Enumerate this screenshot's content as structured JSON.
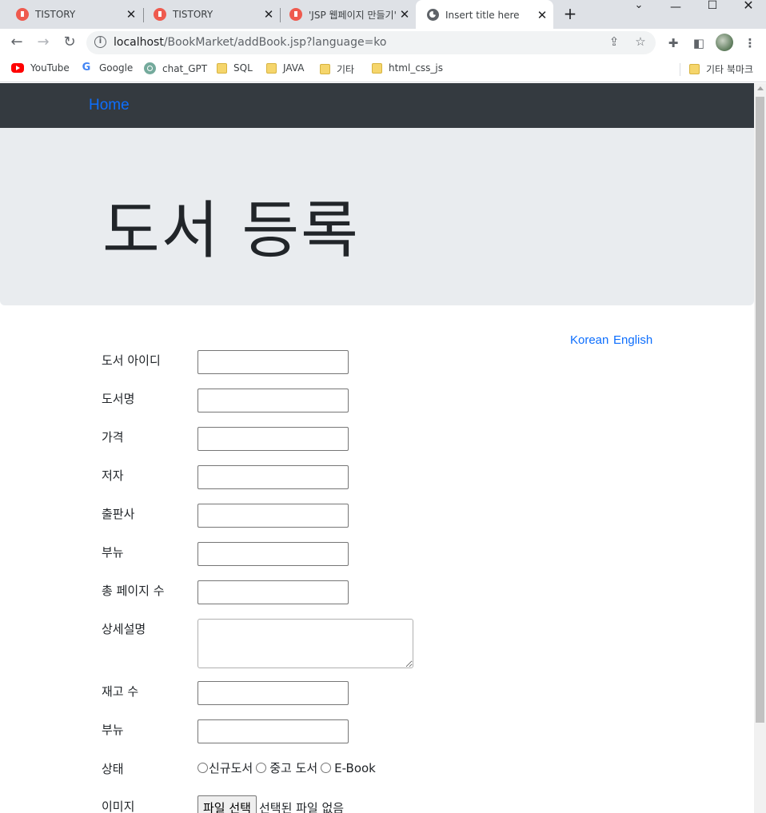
{
  "browser": {
    "tabs": [
      {
        "title": "TISTORY",
        "icon": "tistory-icon"
      },
      {
        "title": "TISTORY",
        "icon": "tistory-icon"
      },
      {
        "title": "'JSP 웹페이지 만들기'",
        "icon": "tistory-icon"
      },
      {
        "title": "Insert title here",
        "icon": "globe-icon",
        "active": true
      }
    ],
    "url_host": "localhost",
    "url_path": "/BookMarket/addBook.jsp?language=ko",
    "bookmarks": [
      {
        "label": "YouTube",
        "icon": "youtube-icon"
      },
      {
        "label": "Google",
        "icon": "google-icon"
      },
      {
        "label": "chat_GPT",
        "icon": "chatgpt-icon"
      },
      {
        "label": "SQL",
        "icon": "folder-icon"
      },
      {
        "label": "JAVA",
        "icon": "folder-icon"
      },
      {
        "label": "기타",
        "icon": "folder-icon"
      },
      {
        "label": "html_css_js",
        "icon": "folder-icon"
      }
    ],
    "other_bookmarks": "기타 북마크"
  },
  "navbar": {
    "brand": "Home"
  },
  "jumbotron": {
    "title": "도서 등록"
  },
  "lang_links": {
    "korean": "Korean",
    "english": "English"
  },
  "form": {
    "fields": [
      {
        "label": "도서 아이디",
        "value": ""
      },
      {
        "label": "도서명",
        "value": ""
      },
      {
        "label": "가격",
        "value": ""
      },
      {
        "label": "저자",
        "value": ""
      },
      {
        "label": "출판사",
        "value": ""
      },
      {
        "label": "부뉴",
        "value": ""
      },
      {
        "label": "총 페이지 수",
        "value": ""
      },
      {
        "label": "상세설명",
        "value": ""
      },
      {
        "label": "재고 수",
        "value": ""
      },
      {
        "label": "부뉴",
        "value": ""
      }
    ],
    "condition": {
      "label": "상태",
      "options": [
        "신규도서",
        "중고 도서",
        "E-Book"
      ]
    },
    "image": {
      "label": "이미지",
      "button": "파일 선택",
      "status": "선택된 파일 없음"
    }
  },
  "colors": {
    "navbar_bg": "#343a40",
    "link": "#0d6efd",
    "jumbotron_bg": "#e9ecef",
    "tab_strip": "#dee1e6"
  }
}
